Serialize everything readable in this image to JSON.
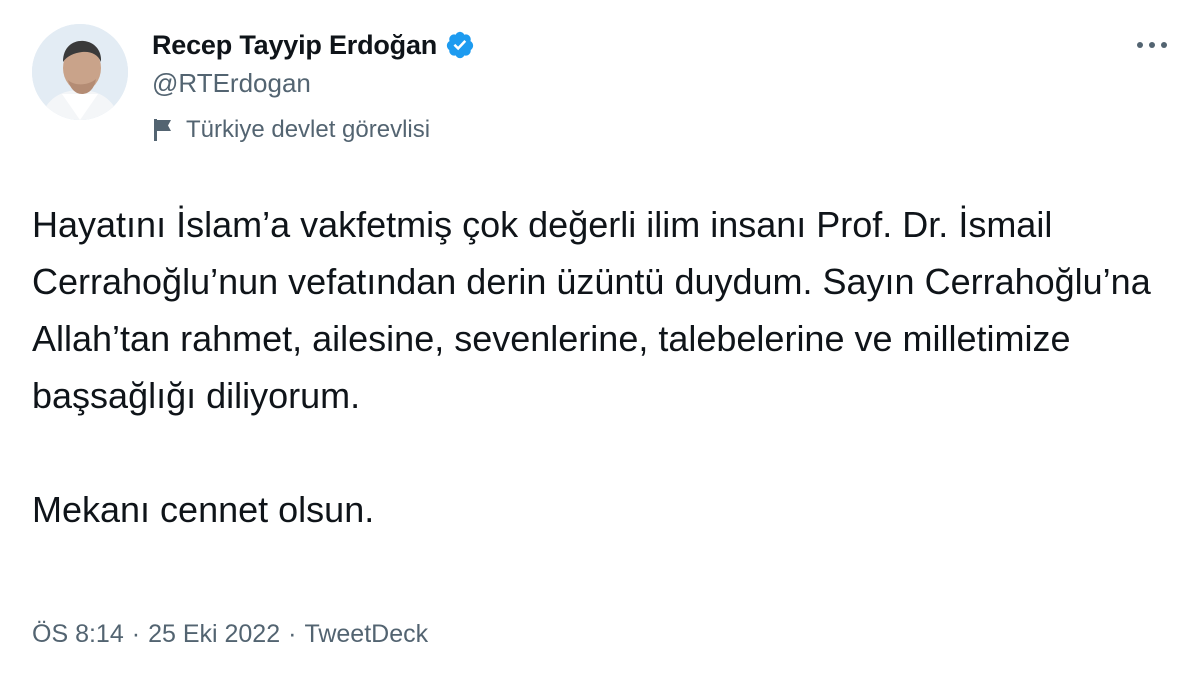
{
  "author": {
    "display_name": "Recep Tayyip Erdoğan",
    "handle": "@RTErdogan",
    "affiliation": "Türkiye devlet görevlisi",
    "verified": true,
    "verified_color": "#1d9bf0"
  },
  "tweet": {
    "paragraph_1": "Hayatını İslam’a vakfetmiş çok değerli ilim insanı Prof. Dr. İsmail Cerrahoğlu’nun vefatından derin üzüntü duydum. Sayın Cerrahoğlu’na Allah’tan rahmet, ailesine, sevenlerine, talebelerine ve milletimize başsağlığı diliyorum.",
    "paragraph_2": "Mekanı cennet olsun."
  },
  "meta": {
    "time": "ÖS 8:14",
    "separator": "·",
    "date": "25 Eki 2022",
    "source": "TweetDeck"
  },
  "icons": {
    "more": "more-horizontal-icon",
    "verified": "verified-badge-icon",
    "affiliation": "flag-icon"
  }
}
